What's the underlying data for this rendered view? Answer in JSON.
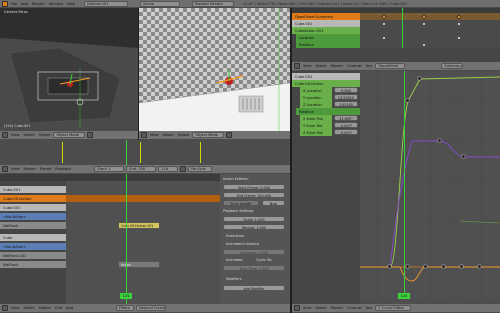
{
  "top_bar": {
    "menus": [
      "File",
      "Add",
      "Render",
      "Window",
      "Help"
    ],
    "layout": "Default.001",
    "scene": "Scene",
    "engine": "Blender Render",
    "stats": "v2.67 | Verts:278 | Faces:264 | Tris:528 | Objects:1/4 | Lamps:0/1 | Mem:14.43M | Cube.001"
  },
  "viewport_left": {
    "label": "Camera Persp",
    "status": "(124) Cube.001",
    "menus": [
      "View",
      "Select",
      "Object"
    ],
    "mode": "Object Mode"
  },
  "viewport_right": {
    "menus": [
      "View",
      "Select",
      "Object"
    ],
    "mode": "Object Mode"
  },
  "dopesheet_top": {
    "rows": [
      "DopeSheet Summary",
      "Cube.001",
      "CubeAction.001",
      "Location",
      "Rotation"
    ]
  },
  "dopesheet_top_header": {
    "menus": [
      "View",
      "Select",
      "Marker",
      "Channel",
      "Key"
    ],
    "mode": "DopeSheet",
    "summary": "Summary"
  },
  "graph_editor": {
    "channels": [
      "Cube.001",
      "Cube.001Action",
      "X Location",
      "Y Location",
      "Z Location",
      "Rotation",
      "X Euler Rot",
      "Y Euler Rot",
      "Z Euler Rot"
    ],
    "values": [
      "0.000",
      "13.55010",
      "1.40185",
      "",
      "31.890°",
      "-0.000°",
      "-0.000°"
    ],
    "menus": [
      "View",
      "Select",
      "Marker",
      "Channel",
      "Key"
    ],
    "mode": "F-Curve Editor",
    "frame_marker": "124",
    "ruler": [
      "-50",
      "0",
      "50",
      "100",
      "150",
      "200",
      "250",
      "300",
      "350"
    ]
  },
  "timeline": {
    "menus": [
      "View",
      "Marker",
      "Frame",
      "Playback"
    ],
    "start": "Start: 1",
    "end": "End: 700",
    "current": "124",
    "sync": "No Sync"
  },
  "nla": {
    "tracks": [
      "Cube.001",
      "Cube.001Action",
      "Cube.001",
      "<No Action>",
      "NlaTrack",
      "Cube",
      "<No Action>",
      "NlaTrack.001",
      "NlaTrack"
    ],
    "strip_label": "Cube.001Action.001",
    "strip2_label": "Action",
    "frame_marker": "124",
    "menus": [
      "View",
      "Select",
      "Marker",
      "Edit",
      "Add"
    ],
    "filters": "Filters",
    "snap": "Nearest Frame"
  },
  "nla_props": {
    "section_extents": "Action Extents:",
    "start_frame": "Start Frame: 0.000",
    "end_frame": "End Frame: 100.000",
    "sync_length": "Sync Length",
    "now": "Now",
    "playback": "Playback Settings:",
    "scale": "Scale: 1.000",
    "repeat": "Repeat: 1.000",
    "evaluation": "Evaluation",
    "animated_influence": "Animated Influence",
    "influence": "Influence: 1.000",
    "animated": "Animated",
    "cyclic": "Cyclic Str",
    "strip_time": "Strip Time: 1.000",
    "modifiers": "Modifiers",
    "add_modifier": "Add Modifier"
  },
  "colors": {
    "orange": "#e07b1a",
    "channel_green": "#6ab04a",
    "nla_blue": "#5b7fb4",
    "frame_green": "#3bd13b",
    "curve_green": "#9ad24a",
    "curve_purple": "#8a4ad2",
    "curve_orange": "#f09a30"
  }
}
